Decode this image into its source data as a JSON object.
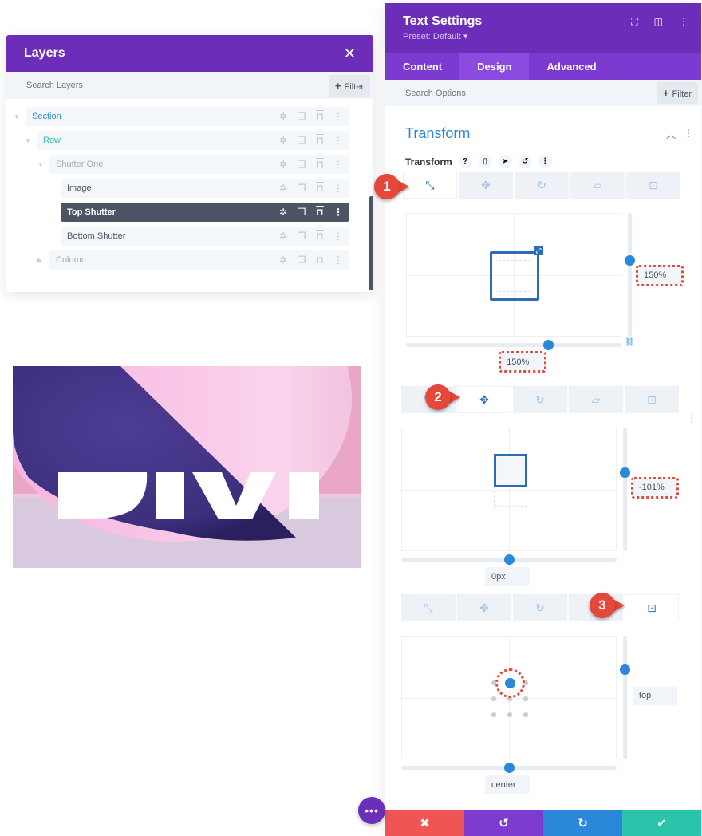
{
  "layers": {
    "title": "Layers",
    "close_icon": "✕",
    "search_placeholder": "Search Layers",
    "filter_label": "Filter",
    "items": [
      {
        "label": "Section",
        "color": "#2b87da",
        "level": 0,
        "expanded": true
      },
      {
        "label": "Row",
        "color": "#29c4a9",
        "level": 1,
        "expanded": true
      },
      {
        "label": "Shutter One",
        "color": "#a2abb5",
        "level": 2,
        "expanded": true
      },
      {
        "label": "Image",
        "color": "#4b5560",
        "level": 3
      },
      {
        "label": "Top Shutter",
        "color": "#ffffff",
        "level": 3,
        "active": true
      },
      {
        "label": "Bottom Shutter",
        "color": "#4b5560",
        "level": 3
      },
      {
        "label": "Column",
        "color": "#a2abb5",
        "level": 2,
        "expanded": false
      }
    ],
    "row_actions": [
      "gear-icon",
      "duplicate-icon",
      "trash-icon",
      "more-icon"
    ]
  },
  "hero": {
    "text": "DIVI",
    "colors": {
      "sphere": "#4b3a8e",
      "pink": "#f6b8e1",
      "floor": "#d2cbe1"
    }
  },
  "settings": {
    "title": "Text Settings",
    "preset": "Preset: Default ▾",
    "header_icons": [
      "fullscreen-icon",
      "split-view-icon",
      "more-icon"
    ],
    "tabs": [
      {
        "label": "Content"
      },
      {
        "label": "Design",
        "active": true
      },
      {
        "label": "Advanced"
      }
    ],
    "search_placeholder": "Search Options",
    "filter_label": "Filter",
    "section_title": "Transform",
    "option_label": "Transform",
    "option_icons": [
      "?",
      "phone-icon",
      "cursor-icon",
      "reset-icon",
      "more-icon"
    ],
    "transform_tabs": [
      "scale",
      "translate",
      "rotate",
      "skew",
      "origin"
    ],
    "blocks": [
      {
        "badge": "1",
        "active_tab": "scale",
        "x_value": "150%",
        "y_value": "150%",
        "x_highlighted": true,
        "y_highlighted": true,
        "x_slider_fraction": 0.66,
        "y_slider_fraction": 0.38
      },
      {
        "badge": "2",
        "active_tab": "translate",
        "x_value": "0px",
        "y_value": "-101%",
        "x_highlighted": false,
        "y_highlighted": true,
        "x_slider_fraction": 0.5,
        "y_slider_fraction": 0.36
      },
      {
        "badge": "3",
        "active_tab": "origin",
        "x_value": "center",
        "y_value": "top",
        "x_highlighted": false,
        "y_highlighted": false,
        "x_slider_fraction": 0.5,
        "y_slider_fraction": 0.27
      }
    ],
    "footer": {
      "cancel_icon": "✖",
      "undo_icon": "↺",
      "redo_icon": "↻",
      "save_icon": "✔",
      "colors": {
        "cancel": "#ef5555",
        "undo": "#7e3bd0",
        "redo": "#2b87da",
        "save": "#29c4a9"
      }
    },
    "fab_label": "•••"
  }
}
